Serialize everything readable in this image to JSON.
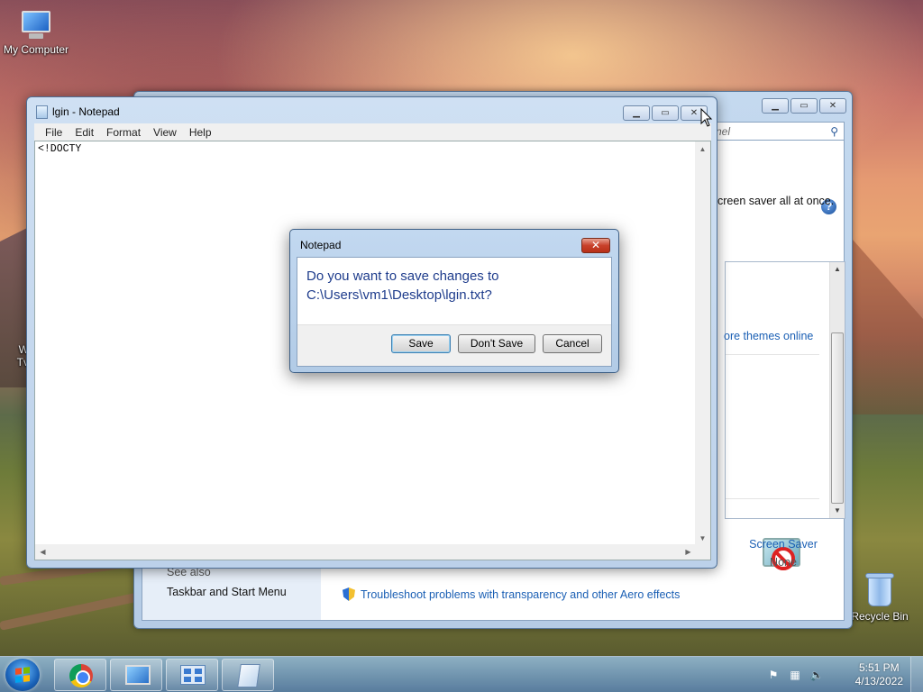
{
  "desktop": {
    "icons": [
      {
        "label": "My Computer"
      },
      {
        "label": "Recycle Bin"
      },
      {
        "label": "W\nTv"
      }
    ]
  },
  "personalization": {
    "search_placeholder": "nel",
    "instructions": "creen saver all at once.",
    "get_more_link": "ore themes online",
    "screen_saver": {
      "label": "Screen Saver",
      "value": "None"
    },
    "see_also": {
      "heading": "See also",
      "items": [
        "Taskbar and Start Menu"
      ]
    },
    "troubleshoot_link": "Troubleshoot problems with transparency and other Aero effects"
  },
  "notepad": {
    "title": "lgin - Notepad",
    "menu": [
      "File",
      "Edit",
      "Format",
      "View",
      "Help"
    ],
    "content": "<!DOCTY"
  },
  "dialog": {
    "title": "Notepad",
    "message_line1": "Do you want to save changes to",
    "message_line2": "C:\\Users\\vm1\\Desktop\\lgin.txt?",
    "buttons": {
      "save": "Save",
      "dont_save": "Don't Save",
      "cancel": "Cancel"
    }
  },
  "taskbar": {
    "clock_time": "5:51 PM",
    "clock_date": "4/13/2022",
    "apps": [
      "chrome-icon",
      "display-icon",
      "control-panel-icon",
      "notepad-icon"
    ]
  },
  "colors": {
    "dialog_text": "#1e3c8c",
    "link": "#1a5fb4"
  }
}
